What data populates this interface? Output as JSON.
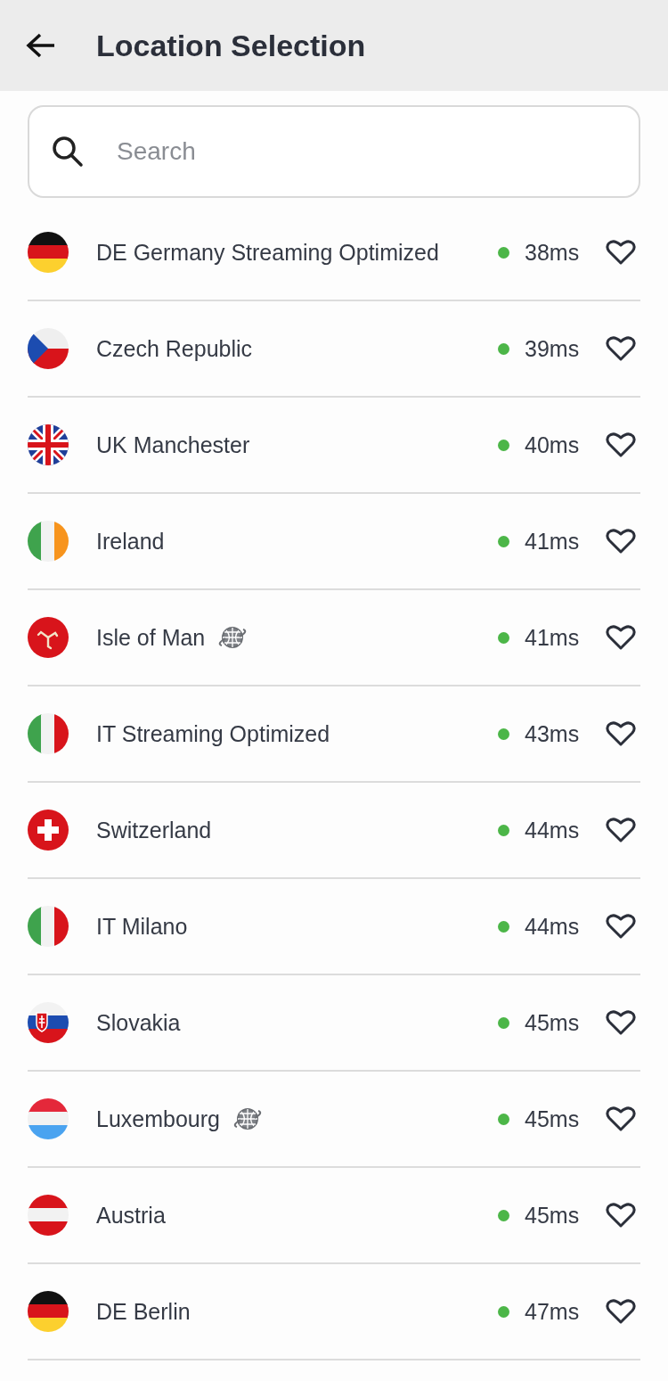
{
  "header": {
    "title": "Location Selection"
  },
  "search": {
    "placeholder": "Search"
  },
  "locations": [
    {
      "kind": "de",
      "name": "DE Germany Streaming Optimized",
      "globe": false,
      "latency": "38ms",
      "favorite": false
    },
    {
      "kind": "cz",
      "name": "Czech Republic",
      "globe": false,
      "latency": "39ms",
      "favorite": false
    },
    {
      "kind": "uk",
      "name": "UK Manchester",
      "globe": false,
      "latency": "40ms",
      "favorite": false
    },
    {
      "kind": "ie",
      "name": "Ireland",
      "globe": false,
      "latency": "41ms",
      "favorite": false
    },
    {
      "kind": "im",
      "name": "Isle of Man",
      "globe": true,
      "latency": "41ms",
      "favorite": false
    },
    {
      "kind": "it",
      "name": "IT Streaming Optimized",
      "globe": false,
      "latency": "43ms",
      "favorite": false
    },
    {
      "kind": "ch",
      "name": "Switzerland",
      "globe": false,
      "latency": "44ms",
      "favorite": false
    },
    {
      "kind": "it",
      "name": "IT Milano",
      "globe": false,
      "latency": "44ms",
      "favorite": false
    },
    {
      "kind": "sk",
      "name": "Slovakia",
      "globe": false,
      "latency": "45ms",
      "favorite": false
    },
    {
      "kind": "lu",
      "name": "Luxembourg",
      "globe": true,
      "latency": "45ms",
      "favorite": false
    },
    {
      "kind": "at",
      "name": "Austria",
      "globe": false,
      "latency": "45ms",
      "favorite": false
    },
    {
      "kind": "de",
      "name": "DE Berlin",
      "globe": false,
      "latency": "47ms",
      "favorite": false
    }
  ]
}
